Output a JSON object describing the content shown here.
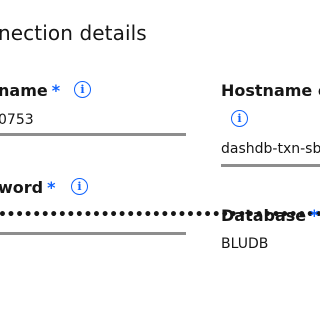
{
  "section": {
    "title": "nection details"
  },
  "fields": {
    "username": {
      "label": "name",
      "required_mark": "*",
      "info_icon": "i",
      "value": "0753"
    },
    "hostname": {
      "label": "Hostname or",
      "info_icon": "i",
      "value": "dashdb-txn-sb"
    },
    "password": {
      "label": "word",
      "required_mark": "*",
      "info_icon": "i",
      "value": "••••••••••••••••••••••••••••••••••••••"
    },
    "database": {
      "label": "Database",
      "required_mark": "*",
      "value": "BLUDB"
    }
  },
  "icons": {
    "info": "information-circle-icon"
  },
  "colors": {
    "accent": "#0f62fe",
    "text": "#161616",
    "border": "#8d8d8d",
    "background": "#ffffff"
  }
}
